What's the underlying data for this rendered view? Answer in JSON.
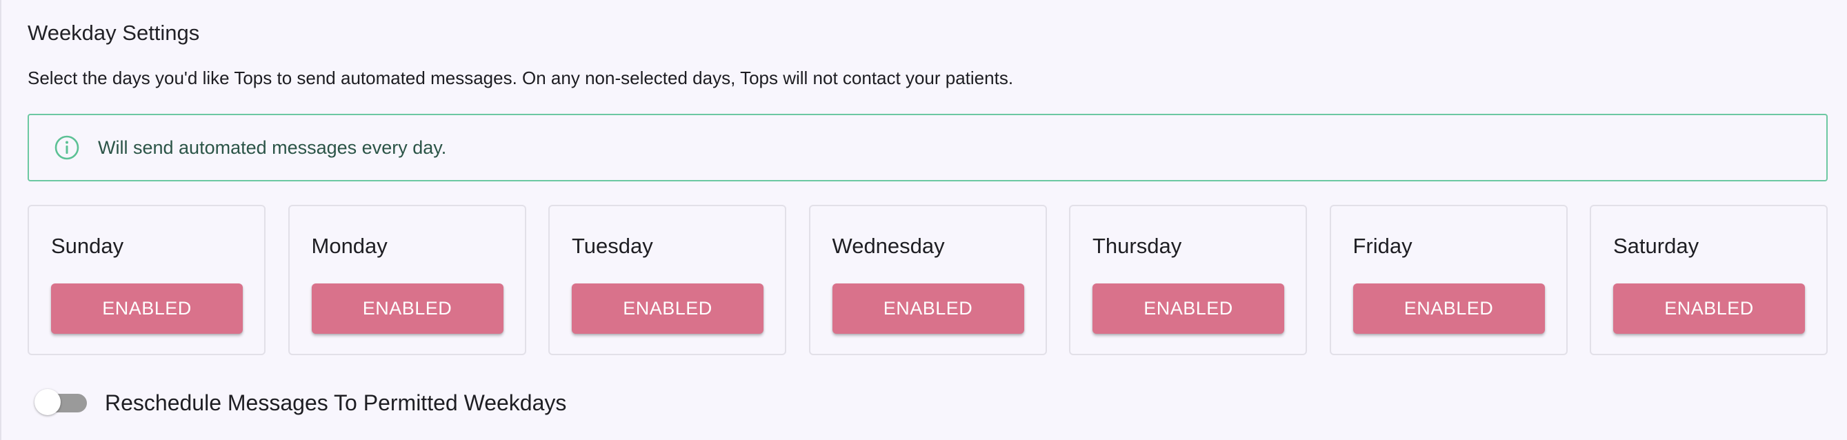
{
  "weekday_settings": {
    "title": "Weekday Settings",
    "description": "Select the days you'd like Tops to send automated messages. On any non-selected days, Tops will not contact your patients.",
    "info_banner": {
      "icon": "info-circle-icon",
      "text": "Will send automated messages every day.",
      "border_color": "#6cc8a2",
      "text_color": "#2b5447"
    },
    "days": [
      {
        "name": "Sunday",
        "status": "ENABLED"
      },
      {
        "name": "Monday",
        "status": "ENABLED"
      },
      {
        "name": "Tuesday",
        "status": "ENABLED"
      },
      {
        "name": "Wednesday",
        "status": "ENABLED"
      },
      {
        "name": "Thursday",
        "status": "ENABLED"
      },
      {
        "name": "Friday",
        "status": "ENABLED"
      },
      {
        "name": "Saturday",
        "status": "ENABLED"
      }
    ],
    "enabled_button_color": "#d9728b",
    "reschedule_toggle": {
      "label": "Reschedule Messages To Permitted Weekdays",
      "checked": false
    }
  }
}
